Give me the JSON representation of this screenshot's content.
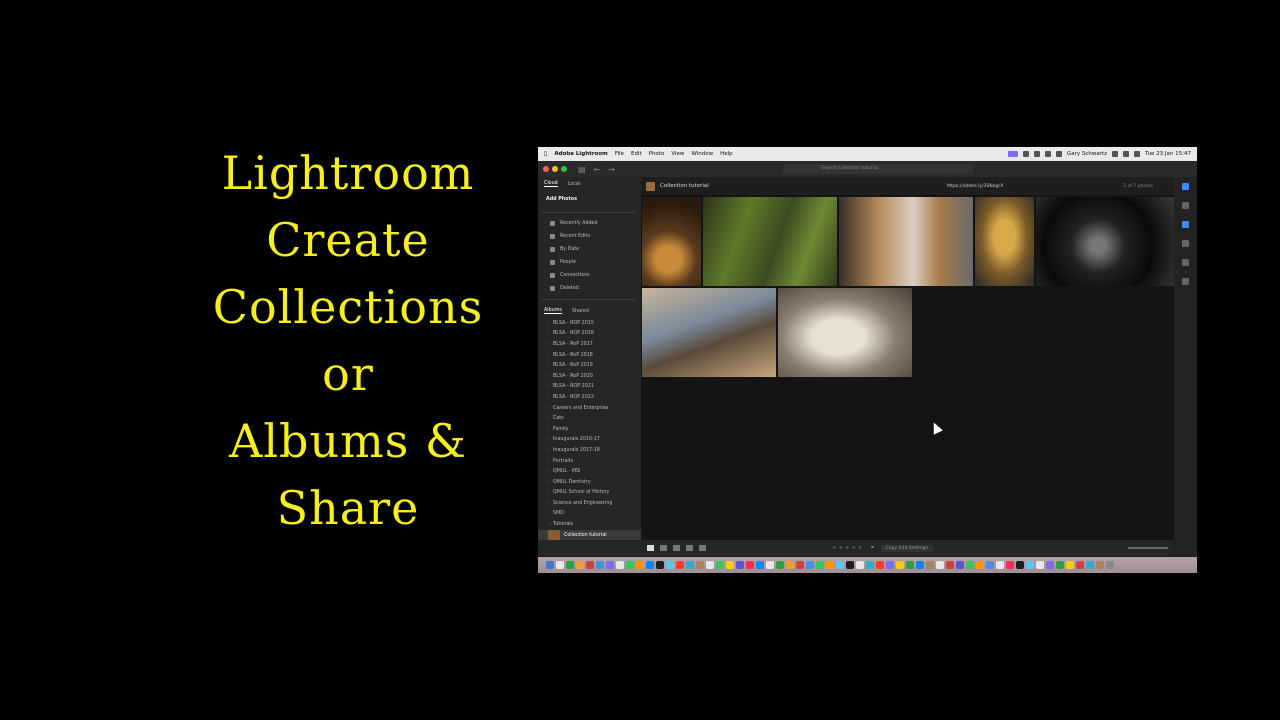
{
  "title_lines": [
    "Lightroom",
    "Create",
    "Collections",
    "or",
    "Albums &",
    "Share"
  ],
  "menubar": {
    "app_name": "Adobe Lightroom",
    "menus": [
      "File",
      "Edit",
      "Photo",
      "View",
      "Window",
      "Help"
    ],
    "user": "Gary Schwartz",
    "datetime": "Tue 23 Jan  15:47"
  },
  "search": {
    "placeholder": "Search Collection tutorial"
  },
  "sidebar": {
    "tabs": [
      "Cloud",
      "Local"
    ],
    "add_photos": "Add Photos",
    "menu_items": [
      "Recently Added",
      "Recent Edits",
      "By Date",
      "People",
      "Connections",
      "Deleted"
    ],
    "album_tabs": [
      "Albums",
      "Shared"
    ],
    "albums": [
      "BLSA - ROP 2015",
      "BLSA - ROP 2016",
      "BLSA - RoP 2017",
      "BLSA - RoP 2018",
      "BLSA - RoP 2019",
      "BLSA - RoP 2020",
      "BLSA - ROP 2021",
      "BLSA - ROP 2022",
      "Careers and Enterprise",
      "Cats",
      "Family",
      "Inaugurals 2016-17",
      "Inaugurals 2017-18",
      "Portraits",
      "QMUL - MSI",
      "QMUL Dentistry",
      "QMUL School of History",
      "Science and Engineering",
      "SMD",
      "Tutorials"
    ],
    "selected_album": "Collection tutorial"
  },
  "main": {
    "title": "Collection tutorial",
    "share_link": "https://adobe.ly/3SNogrX",
    "count": "1 of 7 photos"
  },
  "bottombar": {
    "copy_label": "Copy Edit Settings"
  }
}
